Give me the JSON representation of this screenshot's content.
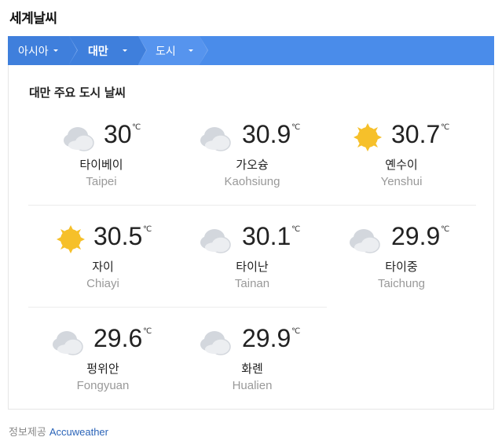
{
  "header": {
    "title": "세계날씨"
  },
  "breadcrumb": {
    "items": [
      "아시아",
      "대만",
      "도시"
    ]
  },
  "card": {
    "title": "대만 주요 도시 날씨"
  },
  "unit": "℃",
  "cities": [
    {
      "name_ko": "타이베이",
      "name_en": "Taipei",
      "temp": "30",
      "icon": "cloudy-icon"
    },
    {
      "name_ko": "가오슝",
      "name_en": "Kaohsiung",
      "temp": "30.9",
      "icon": "cloudy-icon"
    },
    {
      "name_ko": "옌수이",
      "name_en": "Yenshui",
      "temp": "30.7",
      "icon": "sunny-icon"
    },
    {
      "name_ko": "자이",
      "name_en": "Chiayi",
      "temp": "30.5",
      "icon": "sunny-icon"
    },
    {
      "name_ko": "타이난",
      "name_en": "Tainan",
      "temp": "30.1",
      "icon": "cloudy-icon"
    },
    {
      "name_ko": "타이중",
      "name_en": "Taichung",
      "temp": "29.9",
      "icon": "cloudy-icon"
    },
    {
      "name_ko": "펑위안",
      "name_en": "Fongyuan",
      "temp": "29.6",
      "icon": "cloudy-icon"
    },
    {
      "name_ko": "화롄",
      "name_en": "Hualien",
      "temp": "29.9",
      "icon": "cloudy-icon"
    }
  ],
  "footer": {
    "label": "정보제공",
    "source": "Accuweather"
  },
  "colors": {
    "accent": "#4a8cea",
    "sun": "#f6c02a",
    "cloud": "#d3d7dd",
    "link": "#2b64b8"
  }
}
